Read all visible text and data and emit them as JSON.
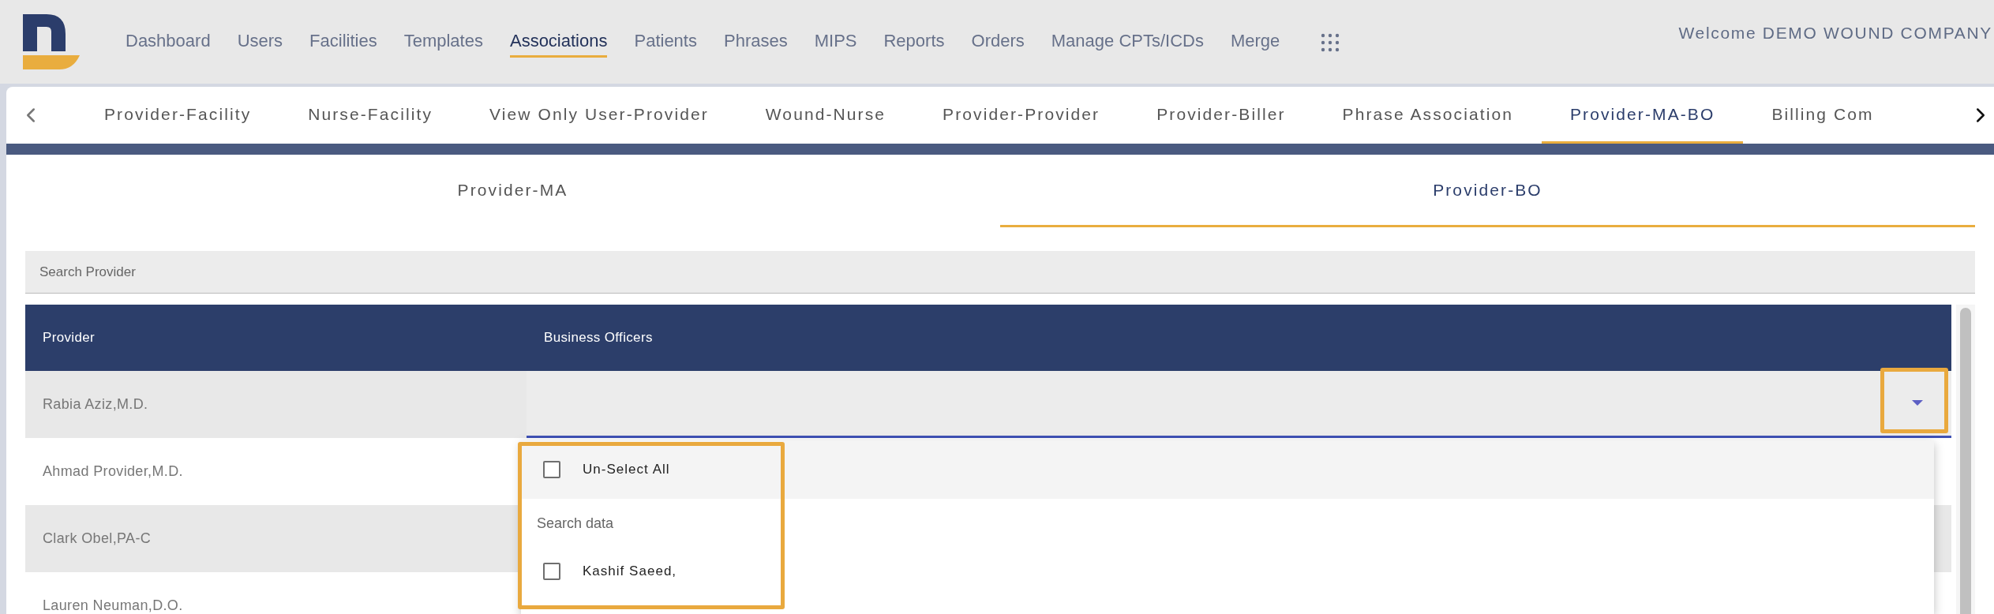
{
  "nav": {
    "items": [
      {
        "label": "Dashboard",
        "selected": false
      },
      {
        "label": "Users",
        "selected": false
      },
      {
        "label": "Facilities",
        "selected": false
      },
      {
        "label": "Templates",
        "selected": false
      },
      {
        "label": "Associations",
        "selected": true
      },
      {
        "label": "Patients",
        "selected": false
      },
      {
        "label": "Phrases",
        "selected": false
      },
      {
        "label": "MIPS",
        "selected": false
      },
      {
        "label": "Reports",
        "selected": false
      },
      {
        "label": "Orders",
        "selected": false
      },
      {
        "label": "Manage CPTs/ICDs",
        "selected": false
      },
      {
        "label": "Merge",
        "selected": false
      }
    ],
    "welcome": "Welcome DEMO WOUND COMPANY"
  },
  "tabs": [
    {
      "label": "Provider-Facility",
      "selected": false
    },
    {
      "label": "Nurse-Facility",
      "selected": false
    },
    {
      "label": "View Only User-Provider",
      "selected": false
    },
    {
      "label": "Wound-Nurse",
      "selected": false
    },
    {
      "label": "Provider-Provider",
      "selected": false
    },
    {
      "label": "Provider-Biller",
      "selected": false
    },
    {
      "label": "Phrase Association",
      "selected": false
    },
    {
      "label": "Provider-MA-BO",
      "selected": true
    },
    {
      "label": "Billing Com",
      "selected": false
    }
  ],
  "subtabs": [
    {
      "label": "Provider-MA",
      "selected": false
    },
    {
      "label": "Provider-BO",
      "selected": true
    }
  ],
  "search": {
    "placeholder": "Search Provider"
  },
  "table": {
    "columns": [
      "Provider",
      "Business Officers"
    ],
    "rows": [
      {
        "provider": "Rabia Aziz,M.D."
      },
      {
        "provider": "Ahmad Provider,M.D."
      },
      {
        "provider": "Clark Obel,PA-C"
      },
      {
        "provider": "Lauren Neuman,D.O."
      }
    ]
  },
  "dropdown": {
    "select_all": {
      "label": "Un-Select All",
      "checked": false
    },
    "search_placeholder": "Search data",
    "options": [
      {
        "label": "Kashif Saeed,",
        "checked": false
      }
    ]
  }
}
